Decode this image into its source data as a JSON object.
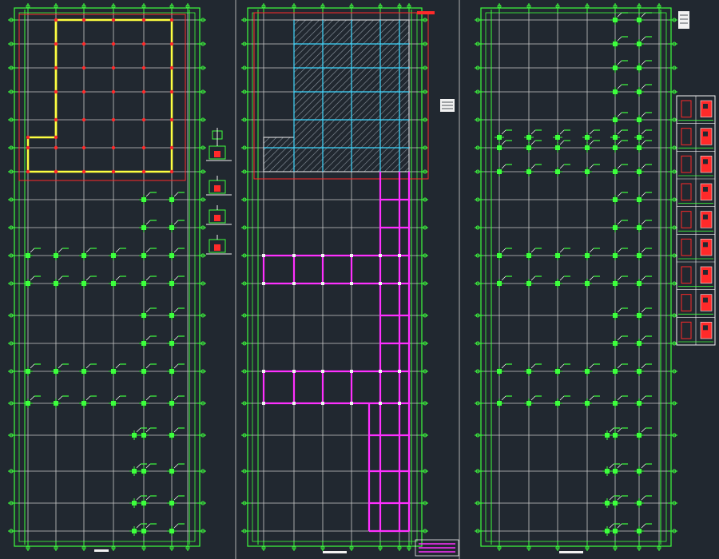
{
  "canvas": {
    "background": "#212830",
    "colors": {
      "green": "#3dff3d",
      "grid": "#c8c8c8",
      "red": "#ff2a2a",
      "yellow": "#ffff40",
      "magenta": "#ff30ff",
      "cyan": "#40d8ff",
      "white": "#f2f2f2",
      "hatch": "#8c96a0",
      "separator": "#b0b0b0"
    }
  },
  "sheets": [
    {
      "id": "sheet-left",
      "content": "foundation-plan",
      "highlight_color": "#ffff40"
    },
    {
      "id": "sheet-middle",
      "content": "floor-framing-plan",
      "highlight_color": "#ff30ff"
    },
    {
      "id": "sheet-right",
      "content": "column-layout-plan",
      "highlight_color": "#3dff3d"
    }
  ],
  "detail_blocks": {
    "left_column_count": 4,
    "right_table_rows": 9
  },
  "icons": [
    "detail-symbol-icon",
    "title-block-icon",
    "north-marker-icon"
  ]
}
